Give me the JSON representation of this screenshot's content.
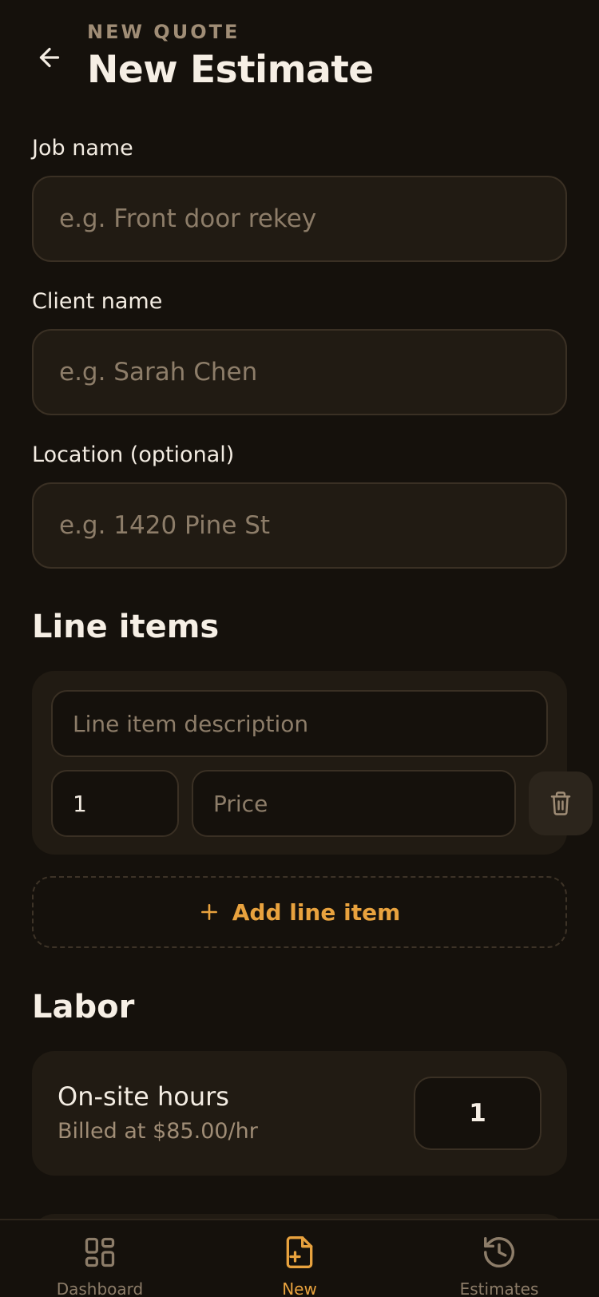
{
  "header": {
    "eyebrow": "NEW QUOTE",
    "title": "New Estimate",
    "back_icon": "arrow-left-icon"
  },
  "form": {
    "job_name": {
      "label": "Job name",
      "placeholder": "e.g. Front door rekey",
      "value": ""
    },
    "client_name": {
      "label": "Client name",
      "placeholder": "e.g. Sarah Chen",
      "value": ""
    },
    "location": {
      "label": "Location (optional)",
      "placeholder": "e.g. 1420 Pine St",
      "value": ""
    }
  },
  "line_items": {
    "title": "Line items",
    "items": [
      {
        "description_placeholder": "Line item description",
        "quantity": "1",
        "price_placeholder": "Price"
      }
    ],
    "delete_icon": "trash-icon",
    "add_label": "Add line item",
    "add_icon": "plus-icon"
  },
  "labor": {
    "title": "Labor",
    "hours_label": "On-site hours",
    "rate_text": "Billed at $85.00/hr",
    "hours_value": "1"
  },
  "nav": {
    "items": [
      {
        "label": "Dashboard",
        "icon": "grid-icon",
        "active": false
      },
      {
        "label": "New",
        "icon": "file-plus-icon",
        "active": true
      },
      {
        "label": "Estimates",
        "icon": "history-icon",
        "active": false
      }
    ]
  },
  "colors": {
    "background": "#15110c",
    "surface": "#211b13",
    "accent": "#e8a23e",
    "text": "#f3ece2",
    "muted": "#8d7d69"
  }
}
